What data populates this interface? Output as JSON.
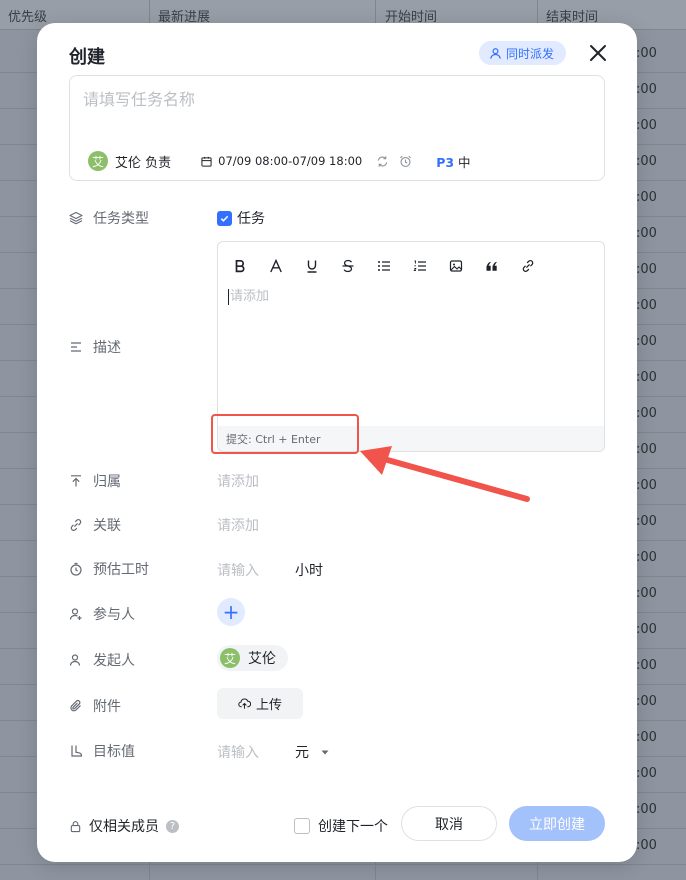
{
  "background": {
    "headers": [
      "优先级",
      "最新进展",
      "开始时间",
      "结束时间"
    ],
    "time_snippets": [
      ":00",
      ":00",
      ":00",
      ":00",
      ":00",
      ":00",
      ":00",
      ":00",
      ":00",
      ":00",
      ":00",
      ":00",
      ":00",
      ":00",
      ":00",
      ":00",
      ":00",
      ":00",
      ":00",
      ":00",
      ":00",
      ":00",
      ":00"
    ]
  },
  "modal": {
    "title": "创建",
    "assign_label": "同时派发",
    "task_name_placeholder": "请填写任务名称",
    "owner": {
      "avatar_text": "艾",
      "name": "艾伦",
      "role": "负责"
    },
    "date_range": "07/09 08:00-07/09 18:00",
    "priority": {
      "code": "P3",
      "level": "中"
    }
  },
  "fields": {
    "task_type": {
      "label": "任务类型",
      "value": "任务"
    },
    "description": {
      "label": "描述",
      "placeholder": "请添加",
      "submit_hint": "提交:  Ctrl + Enter"
    },
    "belongs": {
      "label": "归属",
      "placeholder": "请添加"
    },
    "related": {
      "label": "关联",
      "placeholder": "请添加"
    },
    "estimate": {
      "label": "预估工时",
      "placeholder": "请输入",
      "unit": "小时"
    },
    "participants": {
      "label": "参与人",
      "add": "+"
    },
    "initiator": {
      "label": "发起人",
      "avatar_text": "艾",
      "name": "艾伦"
    },
    "attachment": {
      "label": "附件",
      "upload": "上传"
    },
    "target": {
      "label": "目标值",
      "placeholder": "请输入",
      "unit": "元"
    }
  },
  "footer": {
    "visibility": "仅相关成员",
    "help": "?",
    "create_next": "创建下一个",
    "cancel": "取消",
    "create_now": "立即创建"
  },
  "colors": {
    "accent": "#3370ff",
    "annotation": "#f0544a",
    "create_button": "#a3c1fb"
  }
}
